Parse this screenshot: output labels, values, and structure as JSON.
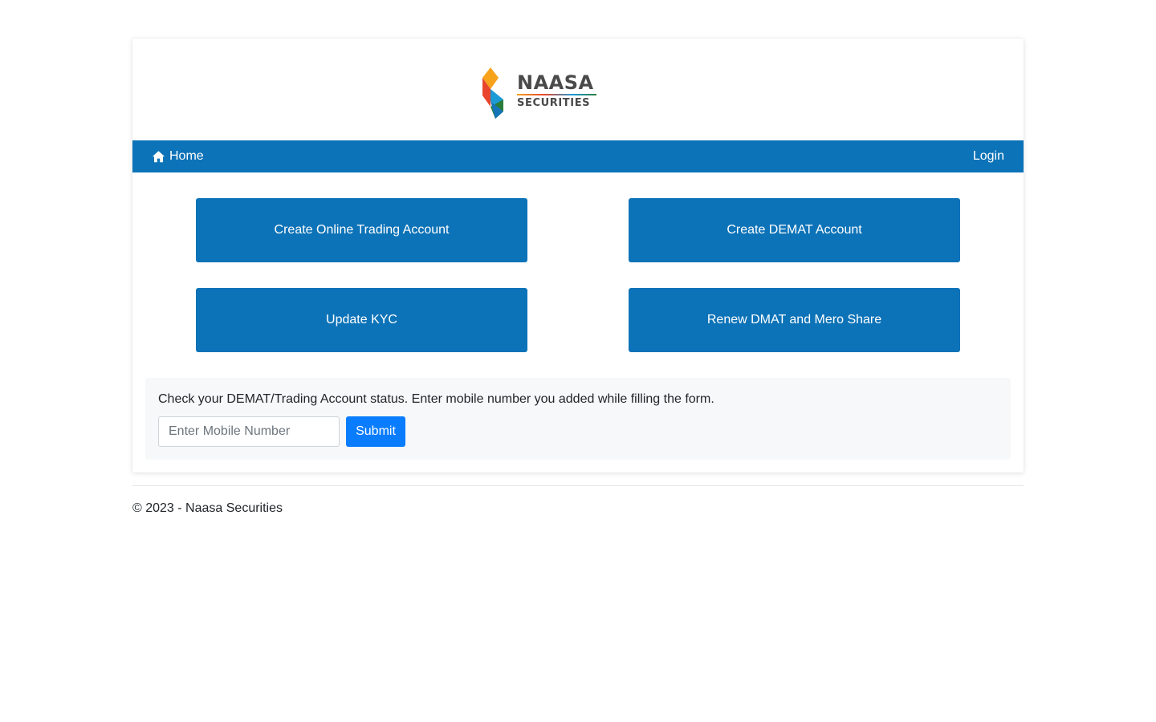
{
  "brand": {
    "logo_line1": "NAASA",
    "logo_line2": "SECURITIES",
    "colors": {
      "orange": "#f7a21b",
      "red": "#e8452c",
      "blue": "#1c9bd7",
      "green": "#2a7d3a",
      "text": "#4a4a4a"
    }
  },
  "navbar": {
    "home_icon": "home-icon",
    "home_label": "Home",
    "login_label": "Login",
    "background": "#0d73b8"
  },
  "actions": [
    {
      "label": "Create Online Trading Account"
    },
    {
      "label": "Create DEMAT Account"
    },
    {
      "label": "Update KYC"
    },
    {
      "label": "Renew DMAT and Mero Share"
    }
  ],
  "status_check": {
    "instruction": "Check your DEMAT/Trading Account status. Enter mobile number you added while filling the form.",
    "mobile_value": "",
    "mobile_placeholder": "Enter Mobile Number",
    "submit_label": "Submit",
    "submit_color": "#0a7dff"
  },
  "footer": {
    "copyright": "© 2023 - Naasa Securities"
  }
}
